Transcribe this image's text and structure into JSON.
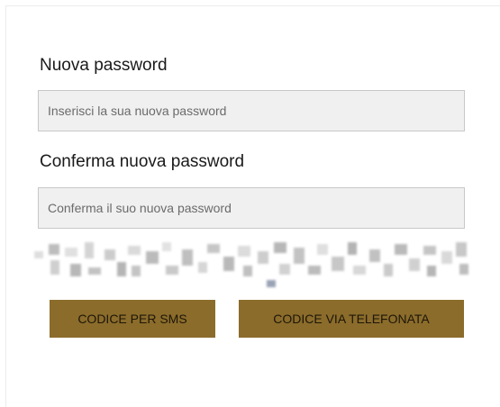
{
  "form": {
    "new_password_label": "Nuova password",
    "new_password_placeholder": "Inserisci la sua nuova password",
    "new_password_value": "",
    "confirm_label": "Conferma nuova password",
    "confirm_placeholder": "Conferma il suo nuova password",
    "confirm_value": ""
  },
  "captcha": {
    "icon": "blurred-captcha-image"
  },
  "buttons": {
    "sms_label": "CODICE PER SMS",
    "call_label": "CODICE VIA TELEFONATA"
  },
  "colors": {
    "button_bg": "#8b6c2b",
    "input_bg": "#f0f0f0"
  }
}
